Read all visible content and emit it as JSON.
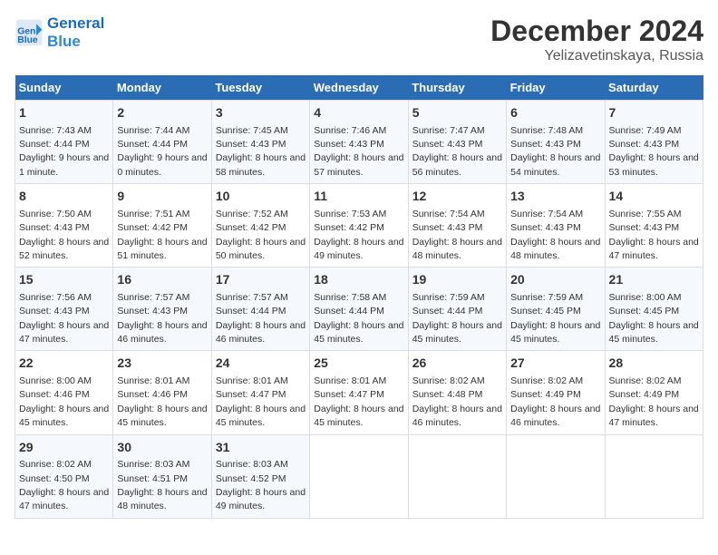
{
  "header": {
    "logo_line1": "General",
    "logo_line2": "Blue",
    "month": "December 2024",
    "location": "Yelizavetinskaya, Russia"
  },
  "days_of_week": [
    "Sunday",
    "Monday",
    "Tuesday",
    "Wednesday",
    "Thursday",
    "Friday",
    "Saturday"
  ],
  "weeks": [
    [
      {
        "day": "1",
        "sunrise": "7:43 AM",
        "sunset": "4:44 PM",
        "daylight": "9 hours and 1 minute."
      },
      {
        "day": "2",
        "sunrise": "7:44 AM",
        "sunset": "4:44 PM",
        "daylight": "9 hours and 0 minutes."
      },
      {
        "day": "3",
        "sunrise": "7:45 AM",
        "sunset": "4:43 PM",
        "daylight": "8 hours and 58 minutes."
      },
      {
        "day": "4",
        "sunrise": "7:46 AM",
        "sunset": "4:43 PM",
        "daylight": "8 hours and 57 minutes."
      },
      {
        "day": "5",
        "sunrise": "7:47 AM",
        "sunset": "4:43 PM",
        "daylight": "8 hours and 56 minutes."
      },
      {
        "day": "6",
        "sunrise": "7:48 AM",
        "sunset": "4:43 PM",
        "daylight": "8 hours and 54 minutes."
      },
      {
        "day": "7",
        "sunrise": "7:49 AM",
        "sunset": "4:43 PM",
        "daylight": "8 hours and 53 minutes."
      }
    ],
    [
      {
        "day": "8",
        "sunrise": "7:50 AM",
        "sunset": "4:43 PM",
        "daylight": "8 hours and 52 minutes."
      },
      {
        "day": "9",
        "sunrise": "7:51 AM",
        "sunset": "4:42 PM",
        "daylight": "8 hours and 51 minutes."
      },
      {
        "day": "10",
        "sunrise": "7:52 AM",
        "sunset": "4:42 PM",
        "daylight": "8 hours and 50 minutes."
      },
      {
        "day": "11",
        "sunrise": "7:53 AM",
        "sunset": "4:42 PM",
        "daylight": "8 hours and 49 minutes."
      },
      {
        "day": "12",
        "sunrise": "7:54 AM",
        "sunset": "4:43 PM",
        "daylight": "8 hours and 48 minutes."
      },
      {
        "day": "13",
        "sunrise": "7:54 AM",
        "sunset": "4:43 PM",
        "daylight": "8 hours and 48 minutes."
      },
      {
        "day": "14",
        "sunrise": "7:55 AM",
        "sunset": "4:43 PM",
        "daylight": "8 hours and 47 minutes."
      }
    ],
    [
      {
        "day": "15",
        "sunrise": "7:56 AM",
        "sunset": "4:43 PM",
        "daylight": "8 hours and 47 minutes."
      },
      {
        "day": "16",
        "sunrise": "7:57 AM",
        "sunset": "4:43 PM",
        "daylight": "8 hours and 46 minutes."
      },
      {
        "day": "17",
        "sunrise": "7:57 AM",
        "sunset": "4:44 PM",
        "daylight": "8 hours and 46 minutes."
      },
      {
        "day": "18",
        "sunrise": "7:58 AM",
        "sunset": "4:44 PM",
        "daylight": "8 hours and 45 minutes."
      },
      {
        "day": "19",
        "sunrise": "7:59 AM",
        "sunset": "4:44 PM",
        "daylight": "8 hours and 45 minutes."
      },
      {
        "day": "20",
        "sunrise": "7:59 AM",
        "sunset": "4:45 PM",
        "daylight": "8 hours and 45 minutes."
      },
      {
        "day": "21",
        "sunrise": "8:00 AM",
        "sunset": "4:45 PM",
        "daylight": "8 hours and 45 minutes."
      }
    ],
    [
      {
        "day": "22",
        "sunrise": "8:00 AM",
        "sunset": "4:46 PM",
        "daylight": "8 hours and 45 minutes."
      },
      {
        "day": "23",
        "sunrise": "8:01 AM",
        "sunset": "4:46 PM",
        "daylight": "8 hours and 45 minutes."
      },
      {
        "day": "24",
        "sunrise": "8:01 AM",
        "sunset": "4:47 PM",
        "daylight": "8 hours and 45 minutes."
      },
      {
        "day": "25",
        "sunrise": "8:01 AM",
        "sunset": "4:47 PM",
        "daylight": "8 hours and 45 minutes."
      },
      {
        "day": "26",
        "sunrise": "8:02 AM",
        "sunset": "4:48 PM",
        "daylight": "8 hours and 46 minutes."
      },
      {
        "day": "27",
        "sunrise": "8:02 AM",
        "sunset": "4:49 PM",
        "daylight": "8 hours and 46 minutes."
      },
      {
        "day": "28",
        "sunrise": "8:02 AM",
        "sunset": "4:49 PM",
        "daylight": "8 hours and 47 minutes."
      }
    ],
    [
      {
        "day": "29",
        "sunrise": "8:02 AM",
        "sunset": "4:50 PM",
        "daylight": "8 hours and 47 minutes."
      },
      {
        "day": "30",
        "sunrise": "8:03 AM",
        "sunset": "4:51 PM",
        "daylight": "8 hours and 48 minutes."
      },
      {
        "day": "31",
        "sunrise": "8:03 AM",
        "sunset": "4:52 PM",
        "daylight": "8 hours and 49 minutes."
      },
      null,
      null,
      null,
      null
    ]
  ]
}
